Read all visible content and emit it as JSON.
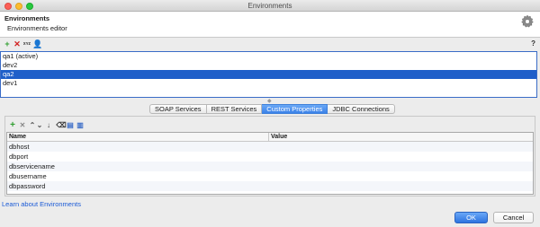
{
  "window": {
    "title": "Environments"
  },
  "header": {
    "title": "Environments",
    "subtitle": "Environments editor",
    "icon": "gear-icon"
  },
  "toolbar": {
    "items": [
      {
        "icon": "add-icon",
        "glyph": "+",
        "color": "#2f9e2f"
      },
      {
        "icon": "delete-icon",
        "glyph": "✕",
        "color": "#d12020"
      },
      {
        "icon": "rename-icon",
        "glyph": "xʏᴢ",
        "color": "#333333"
      },
      {
        "icon": "user-icon",
        "glyph": "👤",
        "color": "#333333"
      }
    ],
    "help": "?"
  },
  "environments": [
    {
      "label": "qa1 (active)",
      "selected": false
    },
    {
      "label": "dev2",
      "selected": false
    },
    {
      "label": "qa2",
      "selected": true
    },
    {
      "label": "dev1",
      "selected": false
    }
  ],
  "tabs": [
    {
      "label": "SOAP Services",
      "active": false
    },
    {
      "label": "REST Services",
      "active": false
    },
    {
      "label": "Custom Properties",
      "active": true
    },
    {
      "label": "JDBC Connections",
      "active": false
    }
  ],
  "props_toolbar": {
    "items": [
      {
        "icon": "add-property-icon",
        "glyph": "+",
        "color": "#2f9e2f"
      },
      {
        "icon": "remove-property-icon",
        "glyph": "✕",
        "color": "#8a8a8a"
      },
      {
        "icon": "move-up-icon",
        "glyph": "⌃",
        "color": "#555555"
      },
      {
        "icon": "move-down-icon",
        "glyph": "⌄",
        "color": "#555555"
      },
      {
        "icon": "arrow-down-icon",
        "glyph": "↓",
        "color": "#333333"
      },
      {
        "icon": "clear-icon",
        "glyph": "⌫",
        "color": "#333333"
      },
      {
        "icon": "load-icon",
        "glyph": "▤",
        "color": "#3a6cc7"
      },
      {
        "icon": "save-icon",
        "glyph": "▥",
        "color": "#3a6cc7"
      }
    ]
  },
  "properties": {
    "columns": [
      "Name",
      "Value"
    ],
    "rows": [
      {
        "name": "dbhost",
        "value": ""
      },
      {
        "name": "dbport",
        "value": ""
      },
      {
        "name": "dbservicename",
        "value": ""
      },
      {
        "name": "dbusername",
        "value": ""
      },
      {
        "name": "dbpassword",
        "value": ""
      }
    ]
  },
  "footer": {
    "link": "Learn about Environments",
    "ok": "OK",
    "cancel": "Cancel"
  },
  "colors": {
    "accent": "#1f5fc9",
    "link": "#1a5ad6"
  }
}
